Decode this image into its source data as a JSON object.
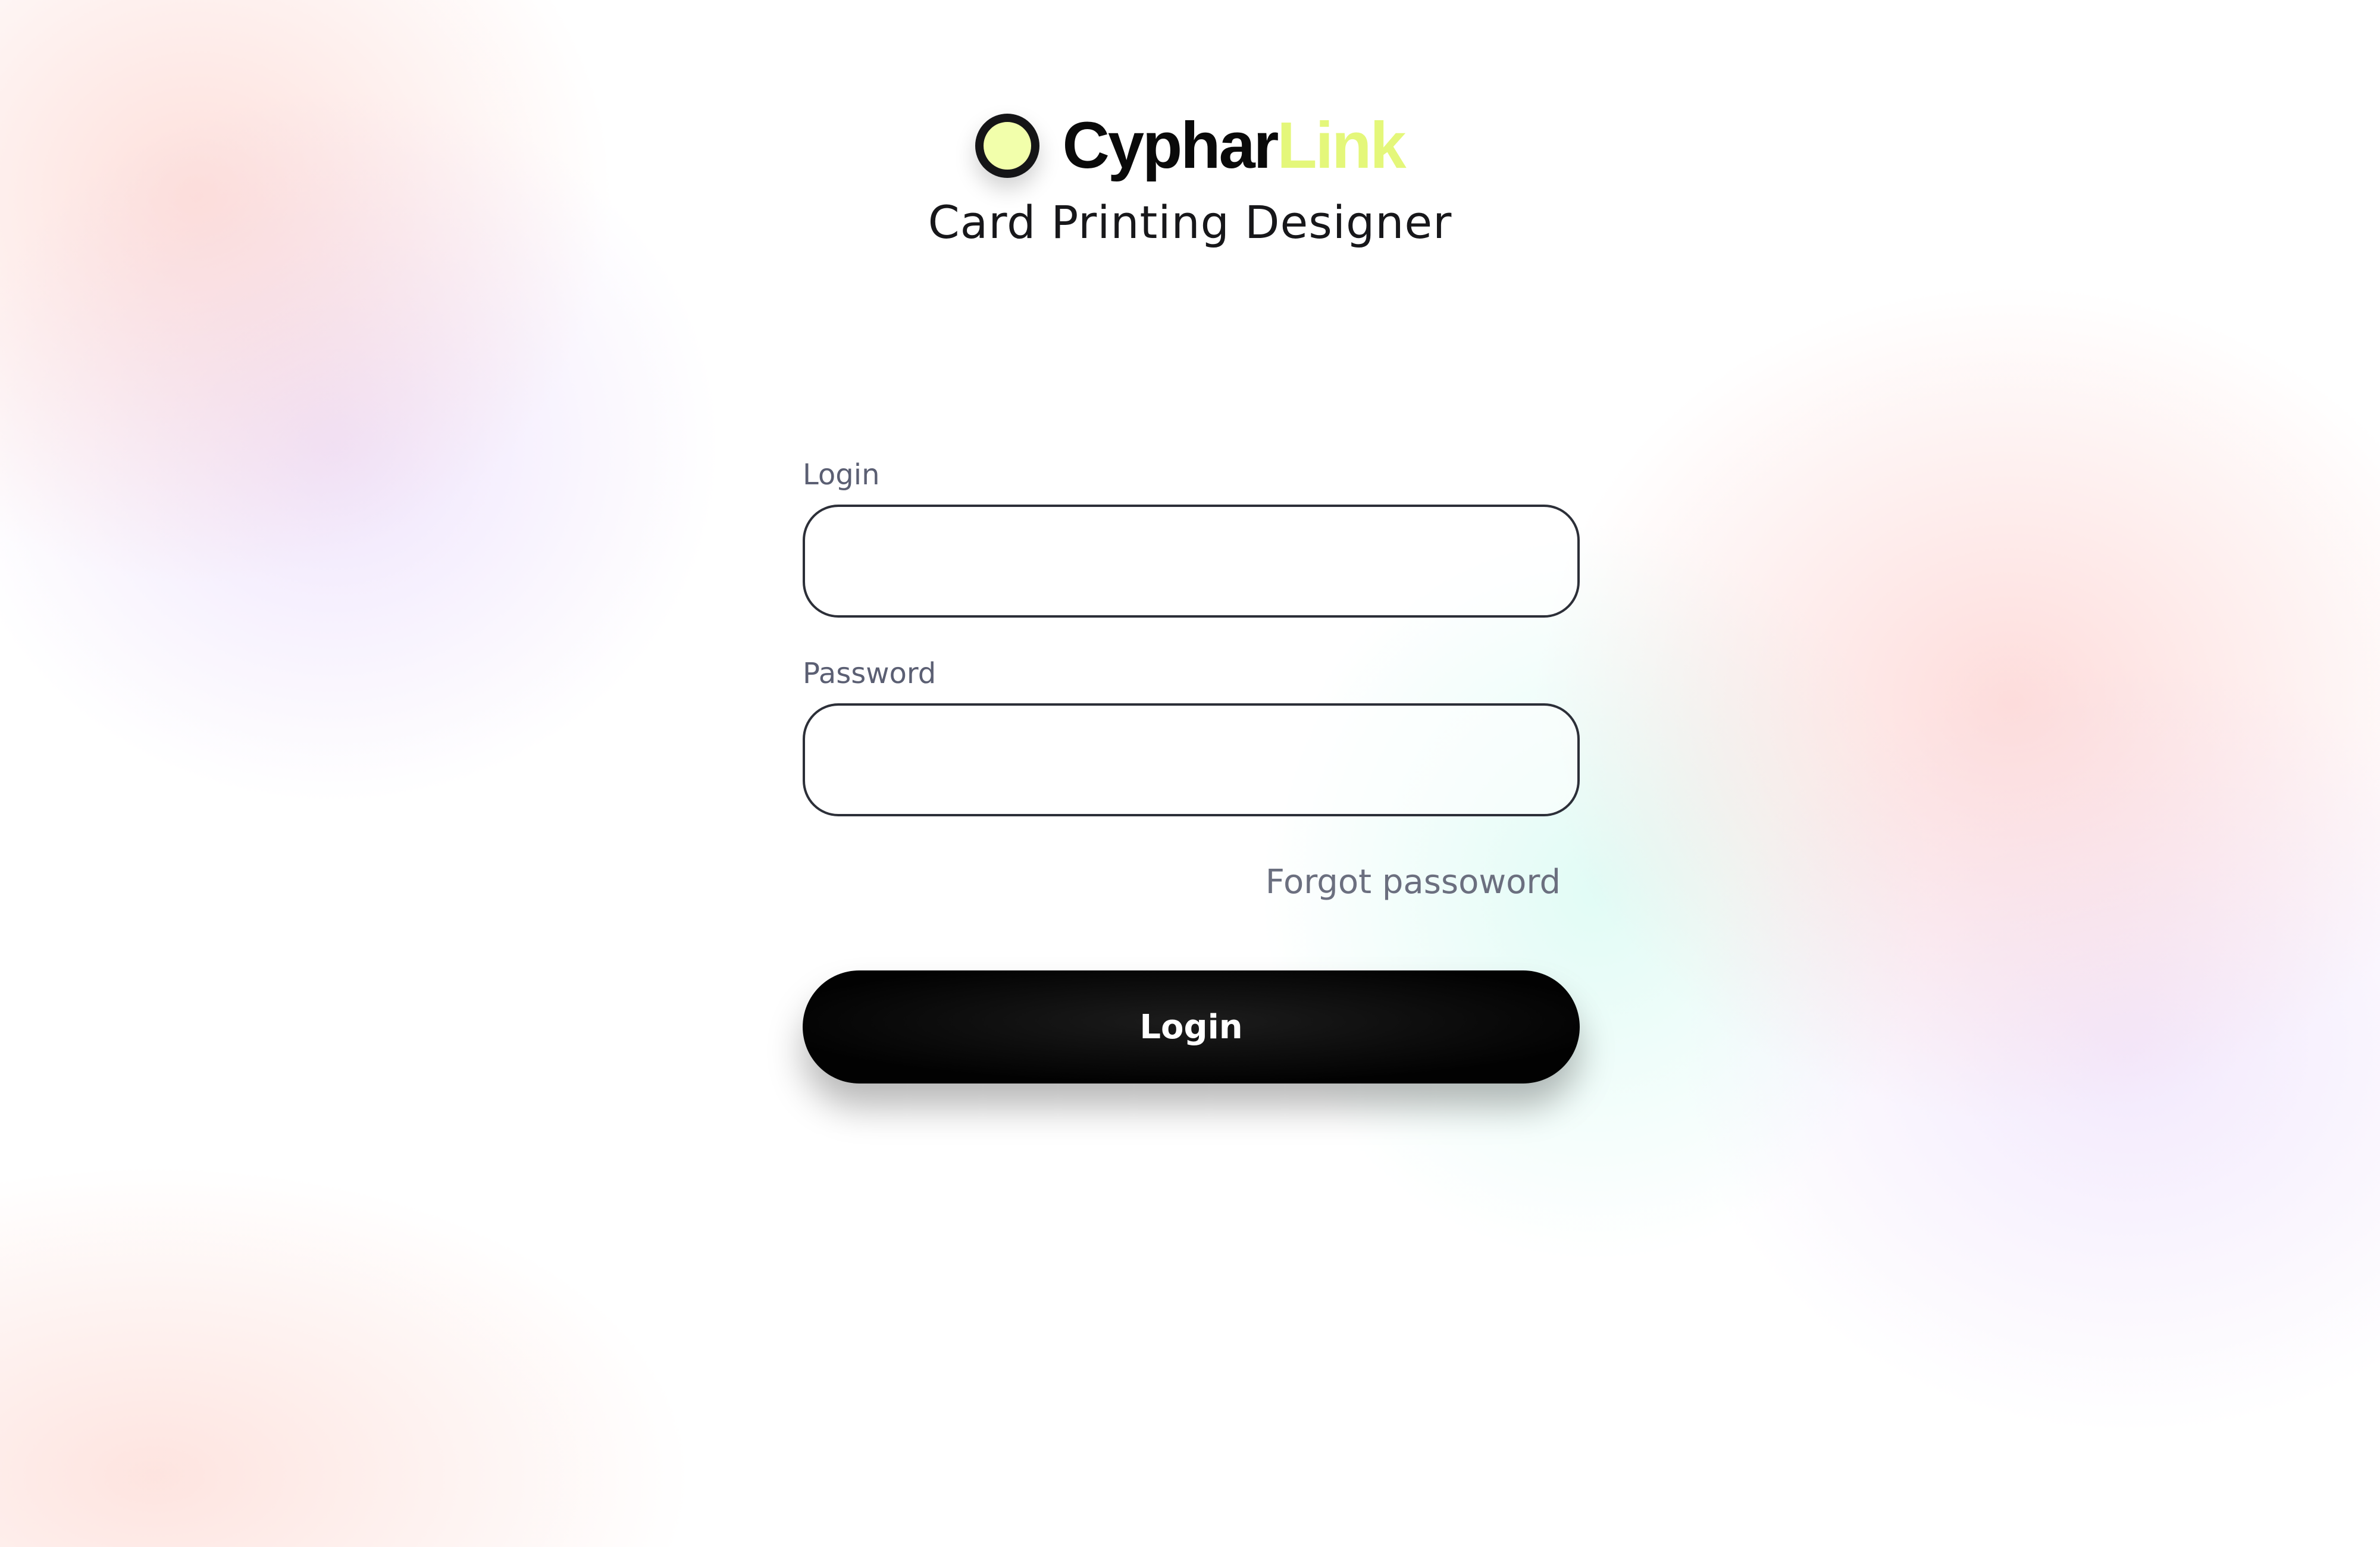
{
  "brand": {
    "name_primary": "Cyphar",
    "name_accent": "Link",
    "subtitle": "Card Printing Designer",
    "icon": "circle-logo-icon",
    "accent_color": "#e4f77a"
  },
  "form": {
    "login_label": "Login",
    "login_value": "",
    "password_label": "Password",
    "password_value": "",
    "forgot_link": "Forgot passoword",
    "submit_label": "Login"
  }
}
